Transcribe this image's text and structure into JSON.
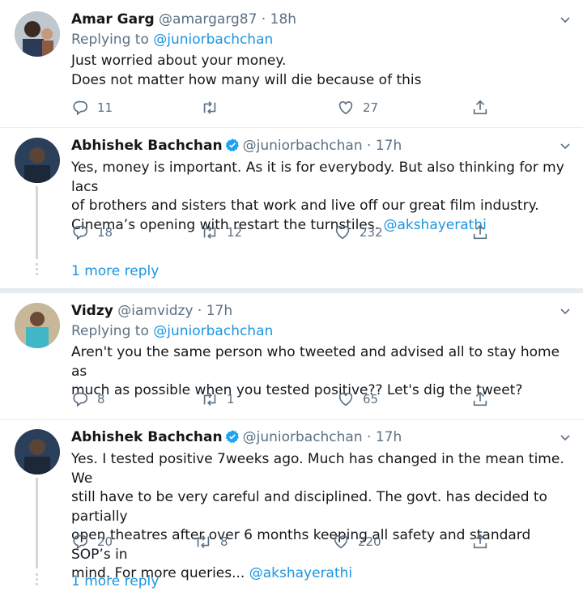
{
  "tweets": [
    {
      "name": "Amar Garg",
      "handle": "@amargarg87",
      "time": "18h",
      "replying_prefix": "Replying to",
      "replying_to": "@juniorbachchan",
      "text_line1": "Just worried about your money.",
      "text_line2": "Does not matter how many will die because of this",
      "replies": "11",
      "retweets": "",
      "likes": "27"
    },
    {
      "name": "Abhishek Bachchan",
      "verified": true,
      "handle": "@juniorbachchan",
      "time": "17h",
      "text_line1": "Yes, money is important. As it is for everybody. But also thinking for my lacs",
      "text_line2": "of brothers and sisters that work and live off our great film industry.",
      "text_line3": "Cinema’s opening with restart the turnstiles.",
      "mention": "@akshayerathi",
      "replies": "18",
      "retweets": "12",
      "likes": "232",
      "more_replies": "1 more reply"
    },
    {
      "name": "Vidzy",
      "handle": "@iamvidzy",
      "time": "17h",
      "replying_prefix": "Replying to",
      "replying_to": "@juniorbachchan",
      "text_line1": "Aren't you the same person who tweeted and advised all to stay home as",
      "text_line2": "much as possible when you tested positive?? Let's dig the tweet?",
      "replies": "8",
      "retweets": "1",
      "likes": "65"
    },
    {
      "name": "Abhishek Bachchan",
      "verified": true,
      "handle": "@juniorbachchan",
      "time": "17h",
      "text_line1": "Yes. I tested positive 7weeks ago. Much has changed in the mean time. We",
      "text_line2": "still have to be very careful and disciplined. The govt. has decided to partially",
      "text_line3": "open theatres after over 6 months keeping all safety and standard SOP’s in",
      "text_line4": "mind. For more queries...",
      "mention": "@akshayerathi",
      "replies": "20",
      "retweets": "8",
      "likes": "220",
      "more_replies": "1 more reply"
    }
  ],
  "separator": "·",
  "colors": {
    "link": "#1b95e0",
    "secondary": "#5b7083",
    "verified": "#1da1f2"
  },
  "icons": [
    "reply-icon",
    "retweet-icon",
    "like-icon",
    "share-icon",
    "verified-badge-icon",
    "chevron-down-icon"
  ]
}
